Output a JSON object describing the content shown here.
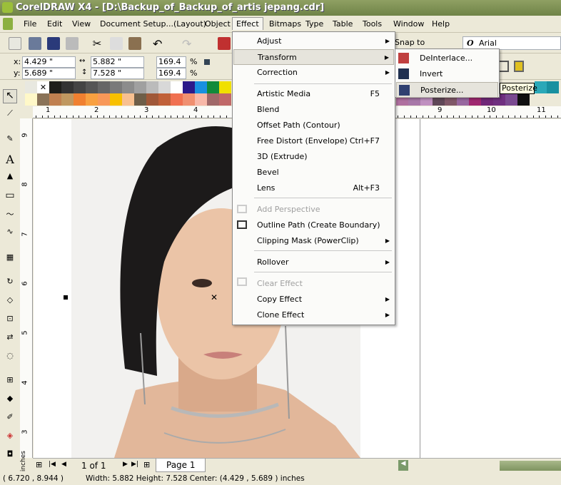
{
  "title": "CorelDRAW X4 - [D:\\Backup_of_Backup_of_artis jepang.cdr]",
  "menubar": [
    "File",
    "Edit",
    "View",
    "Document Setup...(Layout)",
    "Object",
    "Effect",
    "Bitmaps",
    "Type",
    "Table",
    "Tools",
    "Window",
    "Help"
  ],
  "toolbar": {
    "snap_to": "Snap to",
    "font": "Arial"
  },
  "propbar": {
    "x_label": "x:",
    "x": "4.429 \"",
    "y_label": "y:",
    "y": "5.689 \"",
    "width": "5.882 \"",
    "height": "7.528 \"",
    "scale_x": "169.4",
    "scale_y": "169.4",
    "pct": "%"
  },
  "ruler": {
    "h": [
      "1",
      "2",
      "3",
      "4",
      "9",
      "10",
      "11"
    ],
    "v": [
      "9",
      "8",
      "7",
      "6",
      "5",
      "4",
      "3"
    ],
    "units": "inches"
  },
  "effect_menu": [
    {
      "label": "Adjust",
      "submenu": true
    },
    {
      "label": "Transform",
      "submenu": true,
      "highlighted": true
    },
    {
      "label": "Correction",
      "submenu": true
    },
    {
      "label": "Artistic Media",
      "shortcut": "F5"
    },
    {
      "label": "Blend"
    },
    {
      "label": "Offset Path (Contour)"
    },
    {
      "label": "Free Distort (Envelope)",
      "shortcut": "Ctrl+F7"
    },
    {
      "label": "3D (Extrude)"
    },
    {
      "label": "Bevel"
    },
    {
      "label": "Lens",
      "shortcut": "Alt+F3"
    },
    {
      "label": "Add Perspective",
      "disabled": true
    },
    {
      "label": "Outline Path (Create Boundary)"
    },
    {
      "label": "Clipping Mask (PowerClip)",
      "submenu": true
    },
    {
      "label": "Rollover",
      "submenu": true
    },
    {
      "label": "Clear Effect",
      "disabled": true
    },
    {
      "label": "Copy Effect",
      "submenu": true
    },
    {
      "label": "Clone Effect",
      "submenu": true
    }
  ],
  "transform_submenu": [
    {
      "label": "DeInterlace..."
    },
    {
      "label": "Invert"
    },
    {
      "label": "Posterize...",
      "highlighted": true
    }
  ],
  "tooltip": "Posterize",
  "pagebar": {
    "counter": "1 of 1",
    "tab": "Page 1"
  },
  "status": {
    "cursor": "( 6.720 , 8.944 )",
    "info": "Width: 5.882  Height: 7.528  Center: (4.429 , 5.689 ) inches"
  },
  "colors": {
    "title_bar": "#7a8d52",
    "menu_highlight": "#e6e4dc",
    "palette_top": [
      "#1e1e1a",
      "#333333",
      "#444444",
      "#555555",
      "#666666",
      "#7a7a7a",
      "#8c8c8c",
      "#a0a0a0",
      "#bbbbbb",
      "#d8d8d8",
      "#ffffff",
      "#2c1a8a",
      "#1890e0",
      "#118a3a",
      "#f0e000"
    ],
    "palette_bottom": [
      "#fff8c8",
      "#8a7358",
      "#c08050",
      "#c09860",
      "#f08030",
      "#f8a040",
      "#f89858",
      "#f8c000",
      "#f8c090",
      "#6e5e48",
      "#a05838",
      "#c06038",
      "#f07050",
      "#f09070",
      "#f8b8a8",
      "#a06868",
      "#c06868"
    ],
    "palette_right": [
      "#b070a0",
      "#a878a8",
      "#c090c0",
      "#604858",
      "#805868",
      "#9868a0",
      "#a02870",
      "#702878",
      "#703080",
      "#7a4a90",
      "#101010"
    ]
  }
}
